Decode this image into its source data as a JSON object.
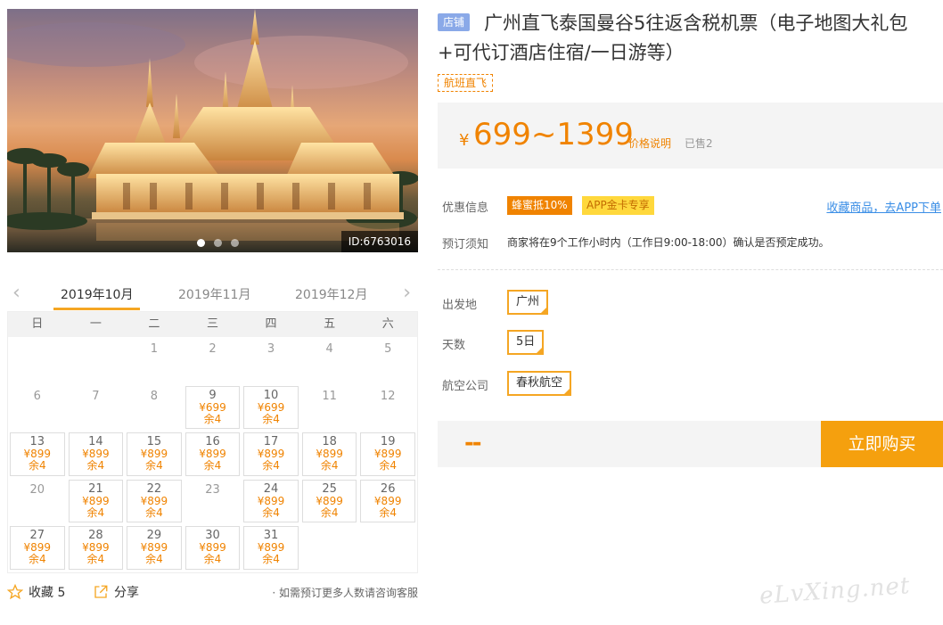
{
  "hero": {
    "id_label": "ID:6763016",
    "slides": 3,
    "active_slide": 0
  },
  "calendar": {
    "months": [
      "2019年10月",
      "2019年11月",
      "2019年12月"
    ],
    "active_month": 0,
    "weekdays": [
      "日",
      "一",
      "二",
      "三",
      "四",
      "五",
      "六"
    ],
    "leading_blanks": 2,
    "days": [
      {
        "d": "1"
      },
      {
        "d": "2"
      },
      {
        "d": "3"
      },
      {
        "d": "4"
      },
      {
        "d": "5"
      },
      {
        "d": "6"
      },
      {
        "d": "7"
      },
      {
        "d": "8"
      },
      {
        "d": "9",
        "price": "¥699",
        "stock": "余4"
      },
      {
        "d": "10",
        "price": "¥699",
        "stock": "余4"
      },
      {
        "d": "11"
      },
      {
        "d": "12"
      },
      {
        "d": "13",
        "price": "¥899",
        "stock": "余4"
      },
      {
        "d": "14",
        "price": "¥899",
        "stock": "余4"
      },
      {
        "d": "15",
        "price": "¥899",
        "stock": "余4"
      },
      {
        "d": "16",
        "price": "¥899",
        "stock": "余4"
      },
      {
        "d": "17",
        "price": "¥899",
        "stock": "余4"
      },
      {
        "d": "18",
        "price": "¥899",
        "stock": "余4"
      },
      {
        "d": "19",
        "price": "¥899",
        "stock": "余4"
      },
      {
        "d": "20"
      },
      {
        "d": "21",
        "price": "¥899",
        "stock": "余4"
      },
      {
        "d": "22",
        "price": "¥899",
        "stock": "余4"
      },
      {
        "d": "23"
      },
      {
        "d": "24",
        "price": "¥899",
        "stock": "余4"
      },
      {
        "d": "25",
        "price": "¥899",
        "stock": "余4"
      },
      {
        "d": "26",
        "price": "¥899",
        "stock": "余4"
      },
      {
        "d": "27",
        "price": "¥899",
        "stock": "余4"
      },
      {
        "d": "28",
        "price": "¥899",
        "stock": "余4"
      },
      {
        "d": "29",
        "price": "¥899",
        "stock": "余4"
      },
      {
        "d": "30",
        "price": "¥899",
        "stock": "余4"
      },
      {
        "d": "31",
        "price": "¥899",
        "stock": "余4"
      }
    ]
  },
  "footer": {
    "favorite_label": "收藏 5",
    "share_label": "分享",
    "consult_text": "· 如需预订更多人数请咨询客服"
  },
  "product": {
    "shop_tag": "店铺",
    "title": "广州直飞泰国曼谷5往返含税机票（电子地图大礼包+可代订酒店住宿/一日游等）",
    "route_tag": "航班直飞",
    "price_symbol": "¥",
    "price": "699~1399",
    "price_note": "价格说明",
    "sold": "已售2",
    "promo_label": "优惠信息",
    "promo_badge_1": "蜂蜜抵10%",
    "promo_badge_2": "APP金卡专享",
    "collect_link": "收藏商品，去APP下单",
    "notice_label": "预订须知",
    "notice_text": "商家将在9个工作小时内（工作日9:00-18:00）确认是否预定成功。",
    "origin_label": "出发地",
    "origin_value": "广州",
    "days_label": "天数",
    "days_value": "5日",
    "airline_label": "航空公司",
    "airline_value": "春秋航空",
    "total_placeholder": "--",
    "buy_label": "立即购买"
  },
  "watermark": "eLvXing.net",
  "colors": {
    "accent": "#f08300",
    "button": "#f5a00e",
    "link": "#3a8ee6",
    "shop_tag": "#8aa9e8"
  }
}
